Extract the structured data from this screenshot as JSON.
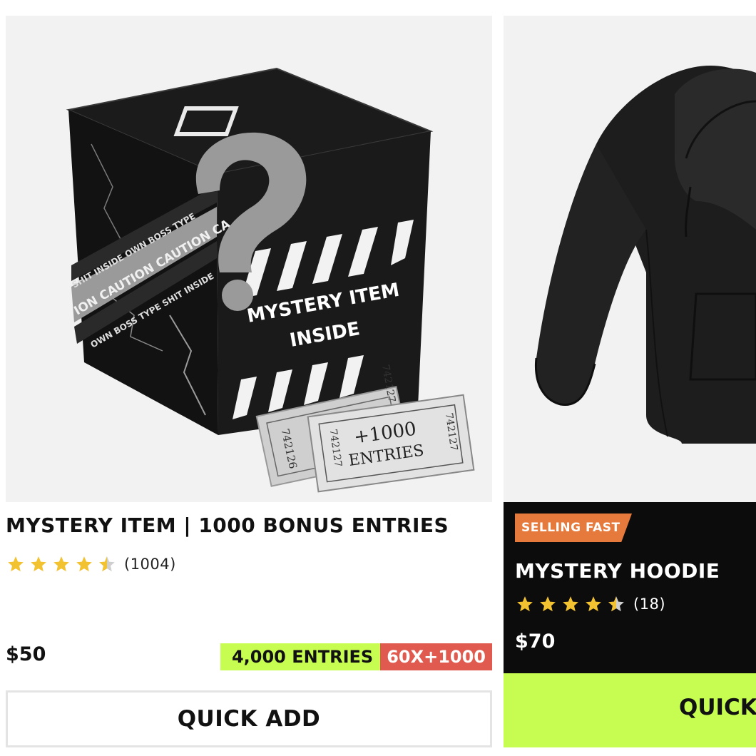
{
  "products": [
    {
      "image_alt": "Mystery box with question mark and tickets",
      "box_text_main": "MYSTERY ITEM",
      "box_text_sub": "INSIDE",
      "tape_text_1": "SHIT INSIDE OWN BOSS TYPE",
      "tape_text_2": "ION CAUTION CAUTION CA",
      "tape_text_3": "OWN BOSS TYPE SHIT INSIDE",
      "ticket_text_1": "+1000",
      "ticket_text_2": "ENTRIES",
      "ticket_num_a": "742126",
      "ticket_num_b": "742127",
      "ticket_num_c": "742127",
      "ticket_num_d": "742127",
      "title": "MYSTERY ITEM | 1000 BONUS ENTRIES",
      "rating": 4.5,
      "rating_count": "(1004)",
      "price": "$50",
      "entries_badge": "4,000 ENTRIES",
      "multiplier_badge": "60X+1000",
      "button_label": "QUICK ADD"
    },
    {
      "badge": "SELLING FAST",
      "title": "MYSTERY HOODIE",
      "rating": 4.5,
      "rating_count": "(18)",
      "price": "$70",
      "button_label": "QUICK"
    }
  ],
  "colors": {
    "star": "#f2c230",
    "star_empty": "#cfcfcf",
    "entries_badge": "#c6fd50",
    "multiplier_badge": "#e05a4f",
    "selling_badge": "#e57a3c",
    "quick_add_green": "#c6fd50",
    "dark_panel": "#0c0c0c"
  },
  "icons": {
    "rating_star": "star-icon",
    "rating_half_star": "half-star-icon"
  }
}
